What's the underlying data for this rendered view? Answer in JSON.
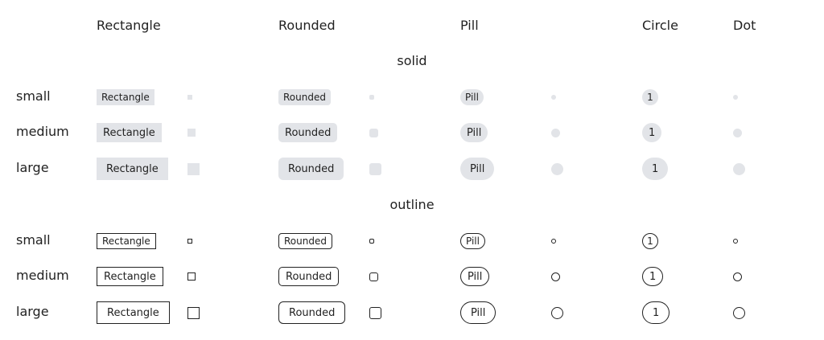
{
  "columns": [
    "Rectangle",
    "Rounded",
    "Pill",
    "Circle",
    "Dot"
  ],
  "sections": [
    {
      "title": "solid",
      "rows": [
        {
          "label": "small",
          "badges": {
            "rectangle": "Rectangle",
            "rounded": "Rounded",
            "pill": "Pill",
            "circle": "1"
          }
        },
        {
          "label": "medium",
          "badges": {
            "rectangle": "Rectangle",
            "rounded": "Rounded",
            "pill": "Pill",
            "circle": "1"
          }
        },
        {
          "label": "large",
          "badges": {
            "rectangle": "Rectangle",
            "rounded": "Rounded",
            "pill": "Pill",
            "circle": "1"
          }
        }
      ]
    },
    {
      "title": "outline",
      "rows": [
        {
          "label": "small",
          "badges": {
            "rectangle": "Rectangle",
            "rounded": "Rounded",
            "pill": "Pill",
            "circle": "1"
          }
        },
        {
          "label": "medium",
          "badges": {
            "rectangle": "Rectangle",
            "rounded": "Rounded",
            "pill": "Pill",
            "circle": "1"
          }
        },
        {
          "label": "large",
          "badges": {
            "rectangle": "Rectangle",
            "rounded": "Rounded",
            "pill": "Pill",
            "circle": "1"
          }
        }
      ]
    }
  ],
  "colors": {
    "solid_fill": "#e2e4e8",
    "outline_border": "#222222",
    "text": "#222222"
  }
}
